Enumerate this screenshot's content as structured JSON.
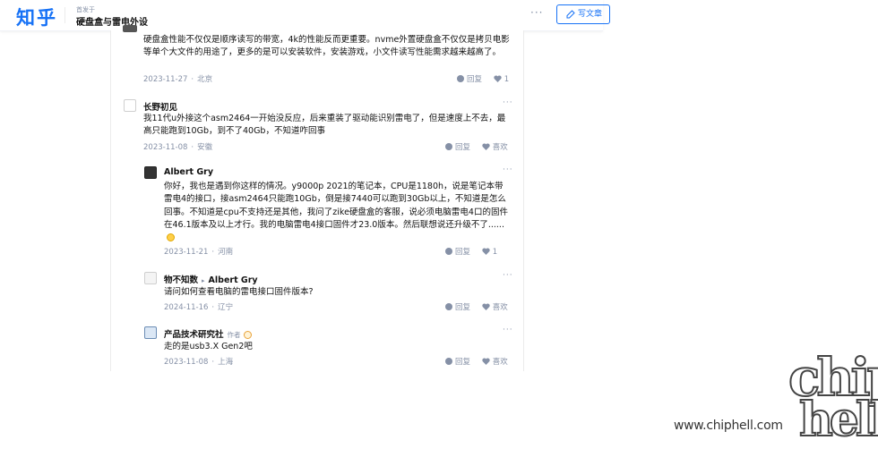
{
  "header": {
    "logo": "知乎",
    "published_in_label": "首发于",
    "column_title": "硬盘盒与雷电外设",
    "more": "···",
    "write_button": "写文章"
  },
  "comments": [
    {
      "text": "硬盘盒性能不仅仅是顺序读写的带宽，4k的性能反而更重要。nvme外置硬盘盒不仅仅是拷贝电影等单个大文件的用途了，更多的是可以安装软件，安装游戏，小文件读写性能需求越来越高了。",
      "date": "2023-11-27",
      "location": "北京",
      "reply": "回复",
      "likes": "1"
    },
    {
      "name": "长野初见",
      "text": "我11代u外接这个asm2464一开始没反应，后来重装了驱动能识别雷电了，但是速度上不去，最高只能跑到10Gb，到不了40Gb，不知道咋回事",
      "date": "2023-11-08",
      "location": "安徽",
      "reply": "回复",
      "like_label": "喜欢"
    },
    {
      "name": "Albert Gry",
      "text": "你好，我也是遇到你这样的情况。y9000p 2021的笔记本，CPU是1180h，说是笔记本带雷电4的接口，接asm2464只能跑10Gb，倒是接7440可以跑到30Gb以上，不知道是怎么回事。不知道是cpu不支持还是其他，我问了zike硬盘盒的客服，说必须电脑雷电4口的固件在46.1版本及以上才行。我的电脑雷电4接口固件才23.0版本。然后联想说还升级不了......",
      "date": "2023-11-21",
      "location": "河南",
      "reply": "回复",
      "likes": "1"
    },
    {
      "name": "物不知数",
      "reply_to": "Albert Gry",
      "text": "请问如何查看电脑的雷电接口固件版本?",
      "date": "2024-11-16",
      "location": "辽宁",
      "reply": "回复",
      "like_label": "喜欢"
    },
    {
      "name": "产品技术研究社",
      "author_tag": "作者",
      "text": "走的是usb3.X Gen2吧",
      "date": "2023-11-08",
      "location": "上海",
      "reply": "回复",
      "like_label": "喜欢"
    }
  ],
  "comment_more": "···",
  "watermark": {
    "url": "www.chiphell.com",
    "logo_top": "chip",
    "logo_bottom": "hell"
  }
}
